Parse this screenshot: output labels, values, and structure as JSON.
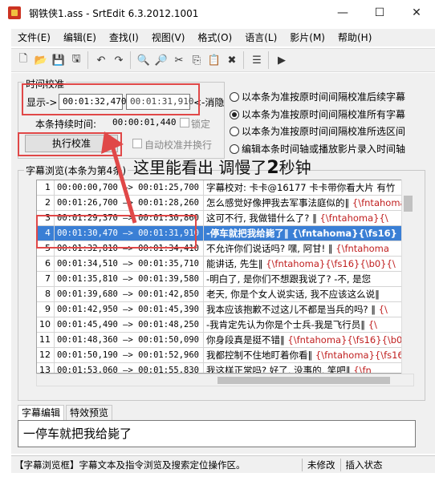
{
  "window": {
    "title": "钢铁侠1.ass - SrtEdit 6.3.2012.1001",
    "minimize": "—",
    "maximize": "☐",
    "close": "✕"
  },
  "menu": [
    "文件(E)",
    "编辑(E)",
    "查找(I)",
    "视图(V)",
    "格式(O)",
    "语言(L)",
    "影片(M)",
    "帮助(H)"
  ],
  "toolbar": {
    "icons": [
      "new-file-icon",
      "open-folder-icon",
      "save-icon",
      "save-all-icon",
      "undo-icon",
      "redo-icon",
      "find-icon",
      "find-replace-icon",
      "cut-icon",
      "copy-icon",
      "paste-icon",
      "delete-icon",
      "list-icon",
      "play-icon"
    ],
    "glyphs": [
      "🗋",
      "📂",
      "💾",
      "🖫",
      "↶",
      "↷",
      "🔍",
      "🔎",
      "✂",
      "⎘",
      "📋",
      "✖",
      "☰",
      "▶"
    ]
  },
  "time_correction": {
    "group_title": "时间校准",
    "display_label": "显示->",
    "original_time": "00:01:32,470",
    "new_time": "00:01:31,910",
    "cancel_label": "<-消隐",
    "duration_label": "本条持续时间:",
    "duration_value": "00:00:01,440",
    "lock_label": "锁定",
    "lock_checked": false,
    "execute_button": "执行校准",
    "auto_label": "自动校准并换行",
    "auto_checked": false
  },
  "radio_options": [
    {
      "label": "以本条为准按原时间间隔校准后续字幕",
      "selected": false
    },
    {
      "label": "以本条为准按原时间间隔校准所有字幕",
      "selected": true
    },
    {
      "label": "以本条为准按原时间间隔校准所选区间",
      "selected": false
    },
    {
      "label": "编辑本条时间轴或播放影片录入时间轴",
      "selected": false
    }
  ],
  "browse": {
    "group_title": "字幕浏览(本条为第4条)",
    "selected_index": 3,
    "rows": [
      {
        "num": "1",
        "time": "00:00:00,700 —> 00:01:25,700",
        "segments": [
          {
            "t": "字幕校对: 卡卡@16177 卡卡带你看大片 有竹"
          }
        ]
      },
      {
        "num": "2",
        "time": "00:01:26,700 —> 00:01:28,260",
        "segments": [
          {
            "t": "怎么感觉好像押我去军事法庭似的‖ "
          },
          {
            "t": "{\\fntahoma}",
            "tag": true
          }
        ]
      },
      {
        "num": "3",
        "time": "00:01:29,370 —> 00:01:30,860",
        "segments": [
          {
            "t": "这可不行, 我做错什么了? ‖ "
          },
          {
            "t": "{\\fntahoma}{\\",
            "tag": true
          }
        ]
      },
      {
        "num": "4",
        "time": "00:01:30,470 —> 00:01:31,910",
        "segments": [
          {
            "t": "-停车就把我给毙了‖ "
          },
          {
            "t": "{\\fntahoma}{\\fs16}",
            "tag": true
          }
        ]
      },
      {
        "num": "5",
        "time": "00:01:32,810 —> 00:01:34,410",
        "segments": [
          {
            "t": "不允许你们说话吗? 嘿, 阿甘! ‖ "
          },
          {
            "t": "{\\fntahoma",
            "tag": true
          }
        ]
      },
      {
        "num": "6",
        "time": "00:01:34,510 —> 00:01:35,710",
        "segments": [
          {
            "t": "能讲话, 先生‖ "
          },
          {
            "t": "{\\fntahoma}{\\fs16}{\\b0}{\\",
            "tag": true
          }
        ]
      },
      {
        "num": "7",
        "time": "00:01:35,810 —> 00:01:39,580",
        "segments": [
          {
            "t": "-明白了, 是你们不想跟我说了? -不, 是您"
          }
        ]
      },
      {
        "num": "8",
        "time": "00:01:39,680 —> 00:01:42,850",
        "segments": [
          {
            "t": "老天, 你是个女人说实话, 我不应该这么说‖"
          }
        ]
      },
      {
        "num": "9",
        "time": "00:01:42,950 —> 00:01:45,390",
        "segments": [
          {
            "t": "我本应该抱歉不过这儿不都是当兵的吗? ‖ "
          },
          {
            "t": "{\\",
            "tag": true
          }
        ]
      },
      {
        "num": "10",
        "time": "00:01:45,490 —> 00:01:48,250",
        "segments": [
          {
            "t": "-我肯定先认为你是个士兵-我是飞行员‖ "
          },
          {
            "t": "{\\",
            "tag": true
          }
        ]
      },
      {
        "num": "11",
        "time": "00:01:48,360 —> 00:01:50,090",
        "segments": [
          {
            "t": "你身段真是挺不错‖ "
          },
          {
            "t": "{\\fntahoma}{\\fs16}{\\b0",
            "tag": true
          }
        ]
      },
      {
        "num": "12",
        "time": "00:01:50,190 —> 00:01:52,960",
        "segments": [
          {
            "t": "我都控制不住地盯着你看‖ "
          },
          {
            "t": "{\\fntahoma}{\\fs16",
            "tag": true
          }
        ]
      },
      {
        "num": "13",
        "time": "00:01:53,060 —> 00:01:55,830",
        "segments": [
          {
            "t": "我这样正常吗? 好了, 没事的, 笑吧‖ "
          },
          {
            "t": "{\\fn",
            "tag": true
          }
        ]
      }
    ]
  },
  "tabs": [
    {
      "label": "字幕编辑",
      "active": true
    },
    {
      "label": "特效预览",
      "active": false
    }
  ],
  "editor": {
    "text": "一停车就把我给毙了"
  },
  "status": {
    "main": "【字幕浏览框】字幕文本及指令浏览及搜索定位操作区。",
    "modified": "未修改",
    "insert": "插入状态"
  },
  "annotation": {
    "text_prefix": "这里能看出 调慢了",
    "number": "2",
    "text_suffix": "秒钟",
    "color": "#e04848"
  }
}
